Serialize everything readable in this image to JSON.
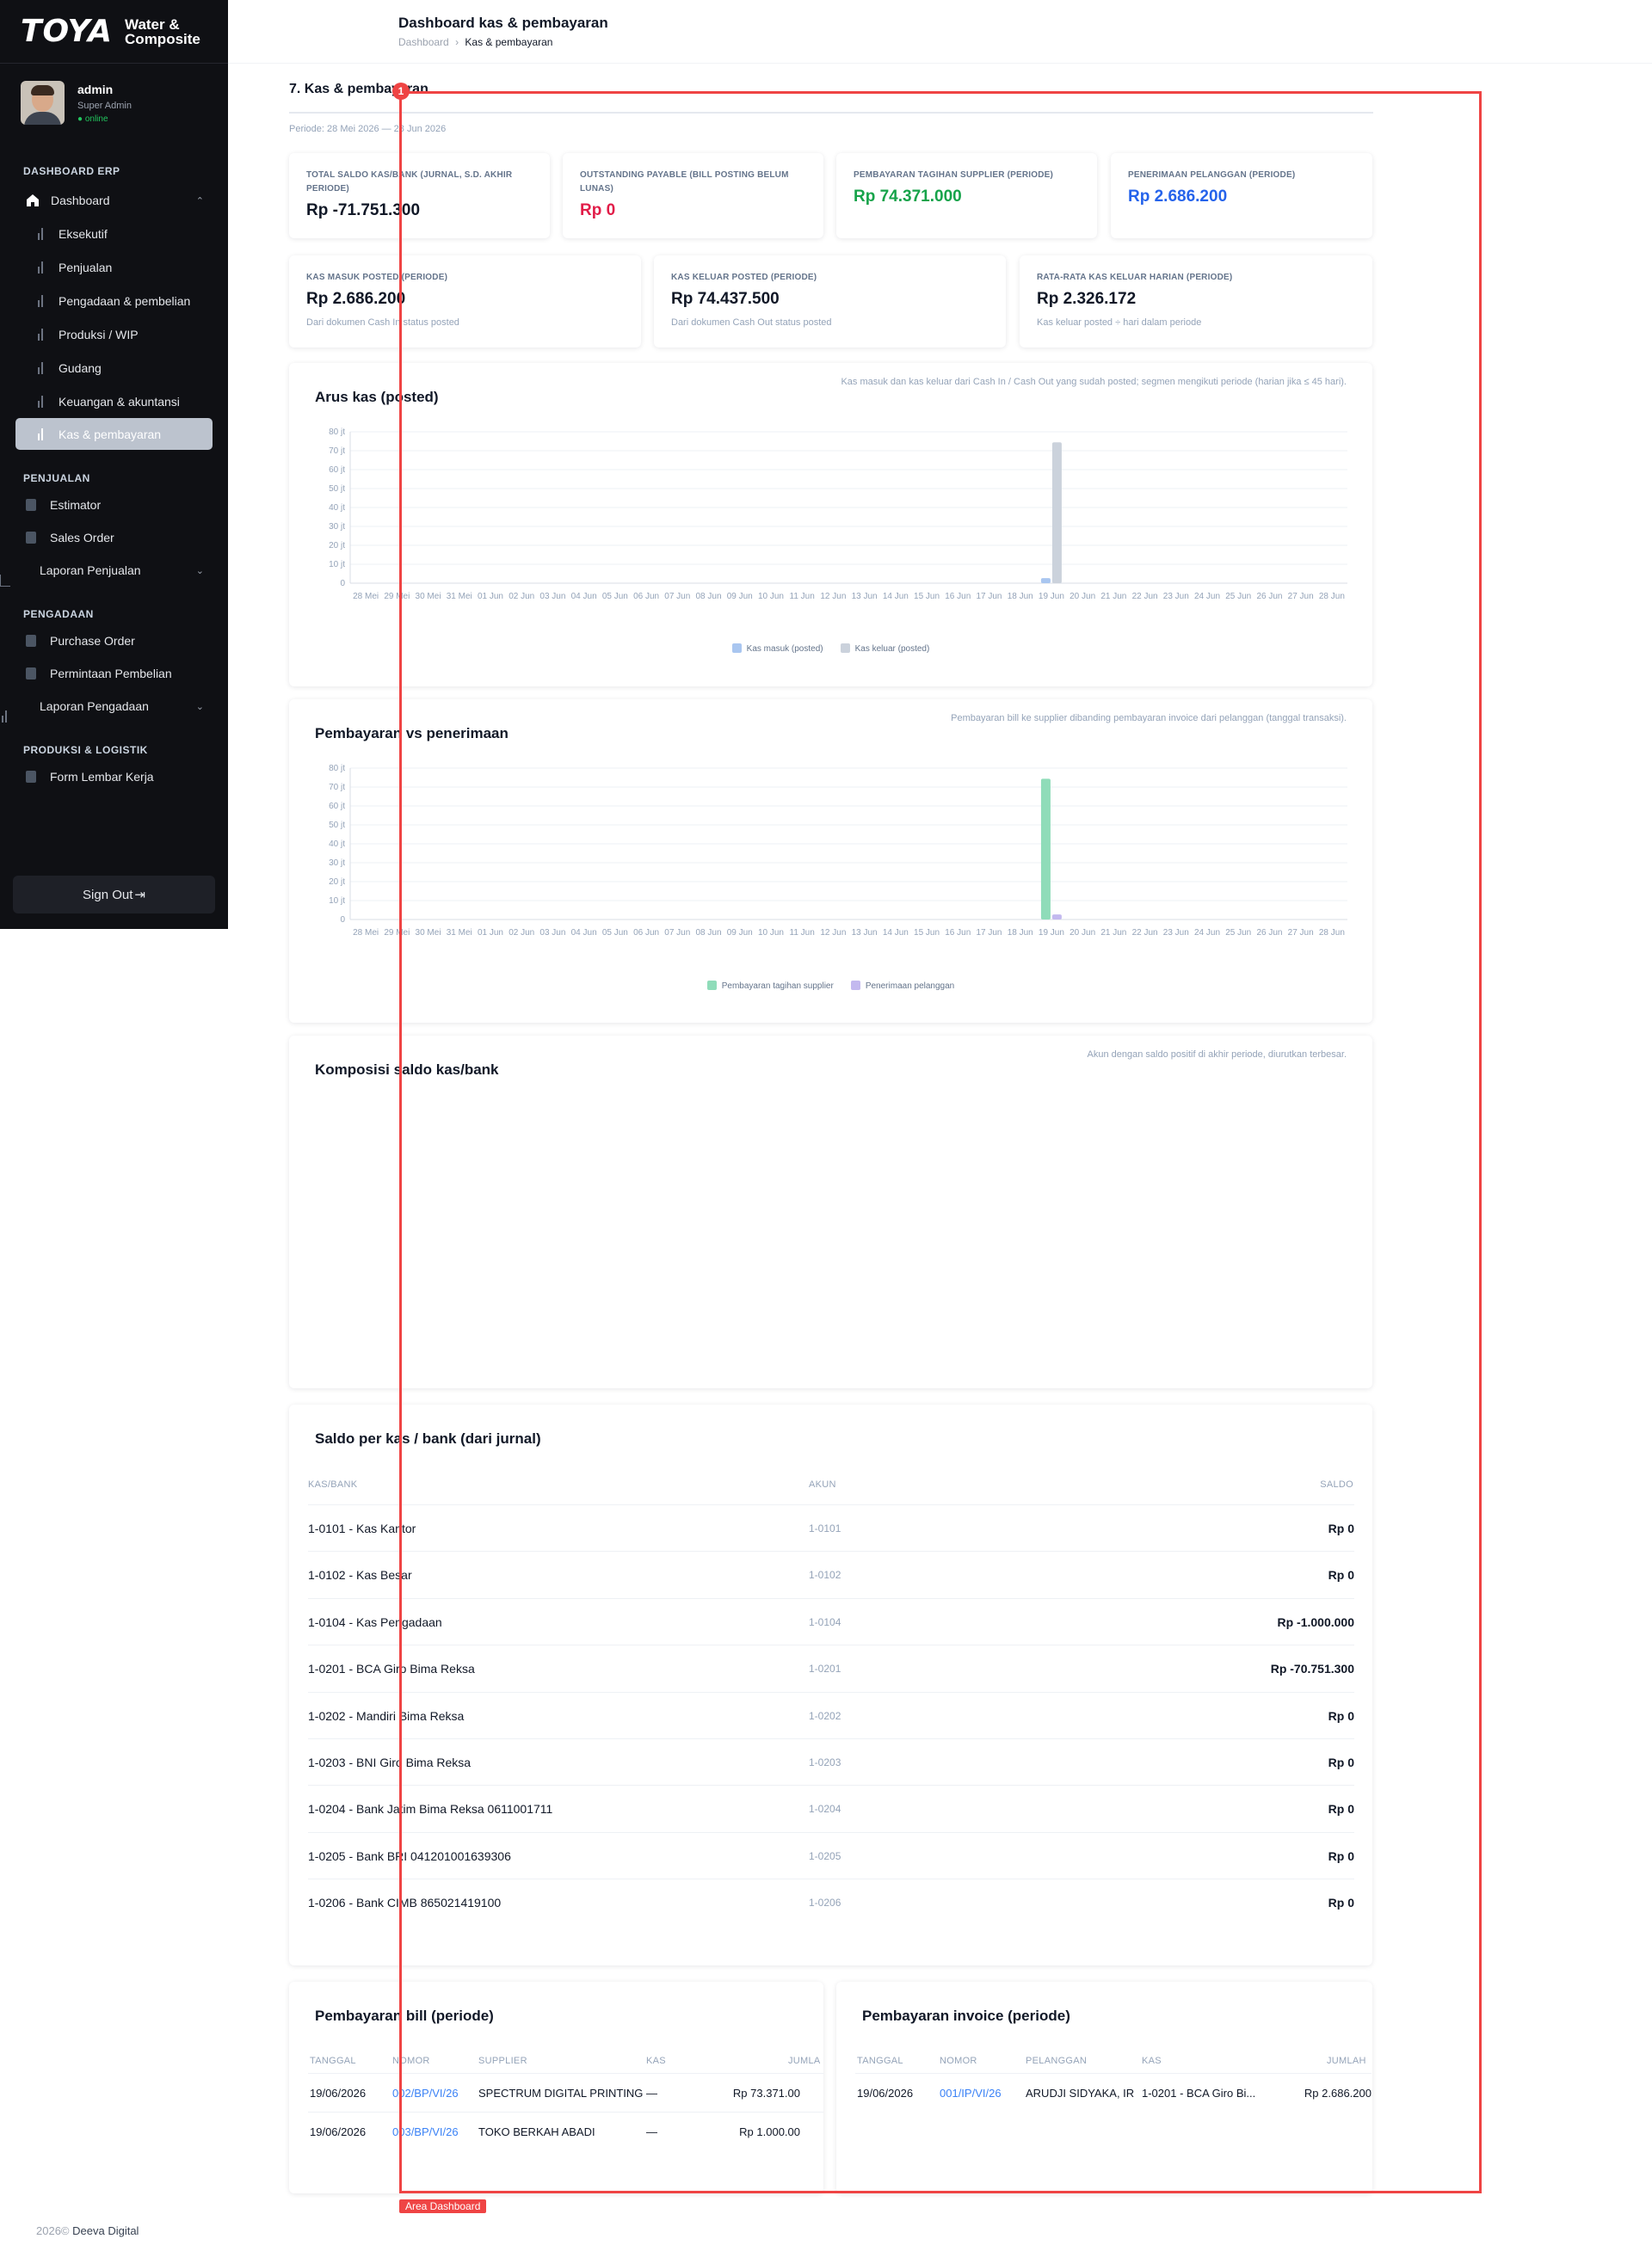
{
  "brand": {
    "logo": "TOYA",
    "subtitle_line1": "Water &",
    "subtitle_line2": "Composite"
  },
  "user": {
    "name": "admin",
    "role": "Super Admin",
    "status": "● online"
  },
  "sidebar": {
    "section_dashboard": "DASHBOARD ERP",
    "dashboard_label": "Dashboard",
    "dashboard_items": [
      {
        "label": "Eksekutif"
      },
      {
        "label": "Penjualan"
      },
      {
        "label": "Pengadaan & pembelian"
      },
      {
        "label": "Produksi / WIP"
      },
      {
        "label": "Gudang"
      },
      {
        "label": "Keuangan & akuntansi"
      },
      {
        "label": "Kas & pembayaran"
      }
    ],
    "section_penjualan": "PENJUALAN",
    "penjualan_items": [
      {
        "label": "Estimator"
      },
      {
        "label": "Sales Order"
      },
      {
        "label": "Laporan Penjualan"
      }
    ],
    "section_pengadaan": "PENGADAAN",
    "pengadaan_items": [
      {
        "label": "Purchase Order"
      },
      {
        "label": "Permintaan Pembelian"
      },
      {
        "label": "Laporan Pengadaan"
      }
    ],
    "section_produksi": "PRODUKSI & LOGISTIK",
    "produksi_items": [
      {
        "label": "Form Lembar Kerja"
      }
    ],
    "signout_label": "Sign Out"
  },
  "header": {
    "title": "Dashboard kas & pembayaran",
    "crumb_root": "Dashboard",
    "crumb_sep": "›",
    "crumb_current": "Kas & pembayaran"
  },
  "section": {
    "title": "7. Kas & pembayaran",
    "periode": "Periode: 28 Mei 2026 — 28 Jun 2026"
  },
  "kpis_row1": [
    {
      "label": "TOTAL SALDO KAS/BANK (JURNAL, S.D. AKHIR PERIODE)",
      "value": "Rp -71.751.300",
      "color": "#111827"
    },
    {
      "label": "OUTSTANDING PAYABLE (BILL POSTING BELUM LUNAS)",
      "value": "Rp 0",
      "color": "#e11d48"
    },
    {
      "label": "PEMBAYARAN TAGIHAN SUPPLIER (PERIODE)",
      "value": "Rp 74.371.000",
      "color": "#16a34a"
    },
    {
      "label": "PENERIMAAN PELANGGAN (PERIODE)",
      "value": "Rp 2.686.200",
      "color": "#2563eb"
    }
  ],
  "kpis_row2": [
    {
      "label": "KAS MASUK POSTED (PERIODE)",
      "value": "Rp 2.686.200",
      "sub": "Dari dokumen Cash In status posted"
    },
    {
      "label": "KAS KELUAR POSTED (PERIODE)",
      "value": "Rp 74.437.500",
      "sub": "Dari dokumen Cash Out status posted"
    },
    {
      "label": "RATA-RATA KAS KELUAR HARIAN (PERIODE)",
      "value": "Rp 2.326.172",
      "sub": "Kas keluar posted ÷ hari dalam periode"
    }
  ],
  "arus_kas": {
    "title": "Arus kas (posted)",
    "note": "Kas masuk dan kas keluar dari Cash In / Cash Out yang sudah posted; segmen mengikuti periode (harian jika ≤ 45 hari).",
    "legend": [
      "Kas masuk (posted)",
      "Kas keluar (posted)"
    ]
  },
  "pembayaran_chart": {
    "title": "Pembayaran vs penerimaan",
    "note": "Pembayaran bill ke supplier dibanding pembayaran invoice dari pelanggan (tanggal transaksi).",
    "legend": [
      "Pembayaran tagihan supplier",
      "Penerimaan pelanggan"
    ]
  },
  "komposisi": {
    "title": "Komposisi saldo kas/bank",
    "note": "Akun dengan saldo positif di akhir periode, diurutkan terbesar."
  },
  "saldo_table": {
    "title": "Saldo per kas / bank (dari jurnal)",
    "headers": [
      "KAS/BANK",
      "AKUN",
      "SALDO"
    ],
    "rows": [
      {
        "name": "1-0101 - Kas Kantor",
        "akun": "1-0101",
        "saldo": "Rp 0"
      },
      {
        "name": "1-0102 - Kas Besar",
        "akun": "1-0102",
        "saldo": "Rp 0"
      },
      {
        "name": "1-0104 - Kas Pengadaan",
        "akun": "1-0104",
        "saldo": "Rp -1.000.000"
      },
      {
        "name": "1-0201 - BCA Giro Bima Reksa",
        "akun": "1-0201",
        "saldo": "Rp -70.751.300"
      },
      {
        "name": "1-0202 - Mandiri Bima Reksa",
        "akun": "1-0202",
        "saldo": "Rp 0"
      },
      {
        "name": "1-0203 - BNI Giro Bima Reksa",
        "akun": "1-0203",
        "saldo": "Rp 0"
      },
      {
        "name": "1-0204 - Bank Jatim Bima Reksa 0611001711",
        "akun": "1-0204",
        "saldo": "Rp 0"
      },
      {
        "name": "1-0205 - Bank BRI 041201001639306",
        "akun": "1-0205",
        "saldo": "Rp 0"
      },
      {
        "name": "1-0206 - Bank CIMB 865021419100",
        "akun": "1-0206",
        "saldo": "Rp 0"
      }
    ]
  },
  "bill_table": {
    "title": "Pembayaran bill (periode)",
    "headers": [
      "TANGGAL",
      "NOMOR",
      "SUPPLIER",
      "KAS",
      "JUMLA"
    ],
    "rows": [
      {
        "tanggal": "19/06/2026",
        "nomor": "002/BP/VI/26",
        "supplier": "SPECTRUM DIGITAL PRINTING",
        "kas": "—",
        "jumlah": "Rp 73.371.00"
      },
      {
        "tanggal": "19/06/2026",
        "nomor": "003/BP/VI/26",
        "supplier": "TOKO BERKAH ABADI",
        "kas": "—",
        "jumlah": "Rp 1.000.00"
      }
    ]
  },
  "invoice_table": {
    "title": "Pembayaran invoice (periode)",
    "headers": [
      "TANGGAL",
      "NOMOR",
      "PELANGGAN",
      "KAS",
      "JUMLAH"
    ],
    "rows": [
      {
        "tanggal": "19/06/2026",
        "nomor": "001/IP/VI/26",
        "pelanggan": "ARUDJI SIDYAKA, IR",
        "kas": "1-0201 - BCA Giro Bi...",
        "jumlah": "Rp 2.686.200"
      }
    ]
  },
  "overlay": {
    "badge": "1",
    "label": "Area Dashboard"
  },
  "footer": {
    "year": "2026©",
    "company": "Deeva Digital"
  },
  "chart_data": [
    {
      "type": "bar",
      "title": "Arus kas (posted)",
      "categories": [
        "28 Mei",
        "29 Mei",
        "30 Mei",
        "31 Mei",
        "01 Jun",
        "02 Jun",
        "03 Jun",
        "04 Jun",
        "05 Jun",
        "06 Jun",
        "07 Jun",
        "08 Jun",
        "09 Jun",
        "10 Jun",
        "11 Jun",
        "12 Jun",
        "13 Jun",
        "14 Jun",
        "15 Jun",
        "16 Jun",
        "17 Jun",
        "18 Jun",
        "19 Jun",
        "20 Jun",
        "21 Jun",
        "22 Jun",
        "23 Jun",
        "24 Jun",
        "25 Jun",
        "26 Jun",
        "27 Jun",
        "28 Jun"
      ],
      "y_ticks": [
        "0",
        "10 jt",
        "20 jt",
        "30 jt",
        "40 jt",
        "50 jt",
        "60 jt",
        "70 jt",
        "80 jt"
      ],
      "ylim": [
        0,
        80
      ],
      "y_unit": "jt",
      "series": [
        {
          "name": "Kas masuk (posted)",
          "color": "#a9c6f0",
          "values": [
            0,
            0,
            0,
            0,
            0,
            0,
            0,
            0,
            0,
            0,
            0,
            0,
            0,
            0,
            0,
            0,
            0,
            0,
            0,
            0,
            0,
            0,
            2.69,
            0,
            0,
            0,
            0,
            0,
            0,
            0,
            0,
            0
          ]
        },
        {
          "name": "Kas keluar (posted)",
          "color": "#cbd2dc",
          "values": [
            0,
            0,
            0,
            0,
            0,
            0,
            0,
            0,
            0,
            0,
            0,
            0,
            0,
            0,
            0,
            0,
            0,
            0,
            0,
            0,
            0,
            0,
            74.44,
            0,
            0,
            0,
            0,
            0,
            0,
            0,
            0,
            0
          ]
        }
      ],
      "grid": true,
      "legend": "bottom"
    },
    {
      "type": "bar",
      "title": "Pembayaran vs penerimaan",
      "categories": [
        "28 Mei",
        "29 Mei",
        "30 Mei",
        "31 Mei",
        "01 Jun",
        "02 Jun",
        "03 Jun",
        "04 Jun",
        "05 Jun",
        "06 Jun",
        "07 Jun",
        "08 Jun",
        "09 Jun",
        "10 Jun",
        "11 Jun",
        "12 Jun",
        "13 Jun",
        "14 Jun",
        "15 Jun",
        "16 Jun",
        "17 Jun",
        "18 Jun",
        "19 Jun",
        "20 Jun",
        "21 Jun",
        "22 Jun",
        "23 Jun",
        "24 Jun",
        "25 Jun",
        "26 Jun",
        "27 Jun",
        "28 Jun"
      ],
      "y_ticks": [
        "0",
        "10 jt",
        "20 jt",
        "30 jt",
        "40 jt",
        "50 jt",
        "60 jt",
        "70 jt",
        "80 jt"
      ],
      "ylim": [
        0,
        80
      ],
      "y_unit": "jt",
      "series": [
        {
          "name": "Pembayaran tagihan supplier",
          "color": "#8fdcb9",
          "values": [
            0,
            0,
            0,
            0,
            0,
            0,
            0,
            0,
            0,
            0,
            0,
            0,
            0,
            0,
            0,
            0,
            0,
            0,
            0,
            0,
            0,
            0,
            74.37,
            0,
            0,
            0,
            0,
            0,
            0,
            0,
            0,
            0
          ]
        },
        {
          "name": "Penerimaan pelanggan",
          "color": "#c3b9ef",
          "values": [
            0,
            0,
            0,
            0,
            0,
            0,
            0,
            0,
            0,
            0,
            0,
            0,
            0,
            0,
            0,
            0,
            0,
            0,
            0,
            0,
            0,
            0,
            2.69,
            0,
            0,
            0,
            0,
            0,
            0,
            0,
            0,
            0
          ]
        }
      ],
      "grid": true,
      "legend": "bottom"
    }
  ]
}
